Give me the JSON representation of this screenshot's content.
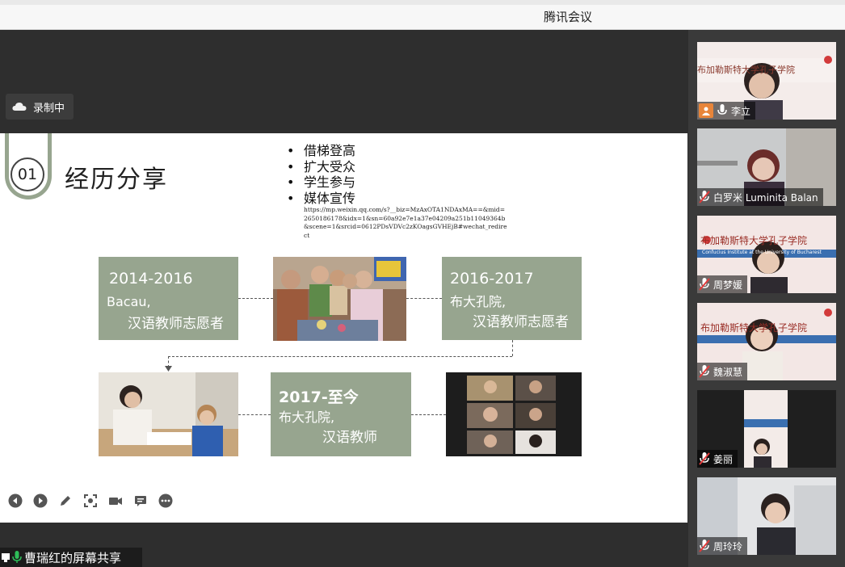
{
  "app": {
    "title": "腾讯会议"
  },
  "recording": {
    "label": "录制中"
  },
  "slide": {
    "number": "01",
    "title": "经历分享",
    "bullets": [
      "借梯登高",
      "扩大受众",
      "学生参与",
      "媒体宣传"
    ],
    "url": "https://mp.weixin.qq.com/s?__biz=MzAxOTA1NDAxMA==&mid=2650186178&idx=1&sn=60a92e7e1a37e04209a251b11049364b&scene=1&srcid=0612PDsVDVc2zKOagsGVHEjB#wechat_redirect",
    "boxes": [
      {
        "line1": "2014-2016",
        "line2": "Bacau,",
        "line3": "汉语教师志愿者"
      },
      {
        "line1": "2016-2017",
        "line2": "布大孔院,",
        "line3": "汉语教师志愿者"
      },
      {
        "line1": "2017-至今",
        "line2": "布大孔院,",
        "line3": "汉语教师"
      }
    ]
  },
  "toolbar": {
    "icons": [
      "prev-icon",
      "next-icon",
      "pen-icon",
      "screenshot-icon",
      "camera-icon",
      "comment-icon",
      "more-icon"
    ]
  },
  "share": {
    "label": "曹瑞红的屏幕共享"
  },
  "participants": [
    {
      "name": "李立",
      "muted": false
    },
    {
      "name": "白罗米 Luminita Balan",
      "muted": true
    },
    {
      "name": "周梦媛",
      "muted": true
    },
    {
      "name": "魏淑慧",
      "muted": true
    },
    {
      "name": "姜丽",
      "muted": true
    },
    {
      "name": "周玲玲",
      "muted": true
    }
  ],
  "backdrop_text": {
    "banner_main": "布加勒斯特大学孔子学院",
    "banner_sub": "Confucius Institute at the University of Bucharest"
  },
  "colors": {
    "sage": "#97a58f",
    "topbar": "#f7f7f7",
    "stage": "#2e2e2e",
    "sidebar": "#3a3a3a",
    "record_icon": "#f0f0f0",
    "mic_muted": "#e23b3b"
  }
}
